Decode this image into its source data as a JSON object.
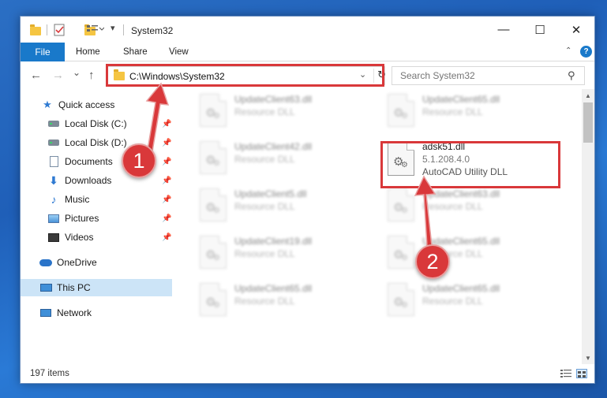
{
  "window": {
    "title": "System32",
    "minimize_glyph": "—",
    "maximize_glyph": "☐",
    "close_glyph": "✕"
  },
  "ribbon": {
    "file_tab": "File",
    "tabs": [
      "Home",
      "Share",
      "View"
    ],
    "help_glyph": "?"
  },
  "nav": {
    "back_glyph": "←",
    "forward_glyph": "→",
    "recent_glyph": "⌄",
    "up_glyph": "↑",
    "address": "C:\\Windows\\System32",
    "dropdown_glyph": "⌄",
    "refresh_glyph": "↻",
    "search_placeholder": "Search System32",
    "search_glyph": "⚲"
  },
  "sidebar": {
    "items": [
      {
        "label": "Quick access",
        "icon": "star-icon",
        "pinned": false
      },
      {
        "label": "Local Disk (C:)",
        "icon": "drive-icon",
        "pinned": true
      },
      {
        "label": "Local Disk (D:)",
        "icon": "drive-icon",
        "pinned": true
      },
      {
        "label": "Documents",
        "icon": "documents-icon",
        "pinned": true
      },
      {
        "label": "Downloads",
        "icon": "downloads-icon",
        "pinned": true
      },
      {
        "label": "Music",
        "icon": "music-icon",
        "pinned": true
      },
      {
        "label": "Pictures",
        "icon": "pictures-icon",
        "pinned": true
      },
      {
        "label": "Videos",
        "icon": "videos-icon",
        "pinned": true
      },
      {
        "label": "OneDrive",
        "icon": "onedrive-icon",
        "pinned": false
      },
      {
        "label": "This PC",
        "icon": "this-pc-icon",
        "pinned": false,
        "selected": true
      },
      {
        "label": "Network",
        "icon": "network-icon",
        "pinned": false
      }
    ],
    "pin_glyph": "📌"
  },
  "files": {
    "left": [
      {
        "name": "UpdateClient63.dll",
        "type": "Resource DLL"
      },
      {
        "name": "UpdateClient42.dll",
        "type": "Resource DLL"
      },
      {
        "name": "UpdateClient5.dll",
        "type": "Resource DLL"
      },
      {
        "name": "UpdateClient19.dll",
        "type": "Resource DLL"
      },
      {
        "name": "UpdateClient65.dll",
        "type": "Resource DLL"
      }
    ],
    "right": [
      {
        "name": "UpdateClient65.dll",
        "type": "Resource DLL"
      },
      {
        "name": "adsk51.dll",
        "version": "5.1.208.4.0",
        "type": "AutoCAD Utility DLL",
        "highlighted": true
      },
      {
        "name": "UpdateClient63.dll",
        "type": "Resource DLL"
      },
      {
        "name": "UpdateClient65.dll",
        "type": "Resource DLL"
      },
      {
        "name": "UpdateClient65.dll",
        "type": "Resource DLL"
      }
    ]
  },
  "status": {
    "item_count": "197 items"
  },
  "annotations": {
    "step1_label": "1",
    "step2_label": "2",
    "color": "#d9383a"
  },
  "colors": {
    "accent": "#1979ca",
    "selection": "#cce4f7",
    "desktop": "#2b6fc4"
  }
}
